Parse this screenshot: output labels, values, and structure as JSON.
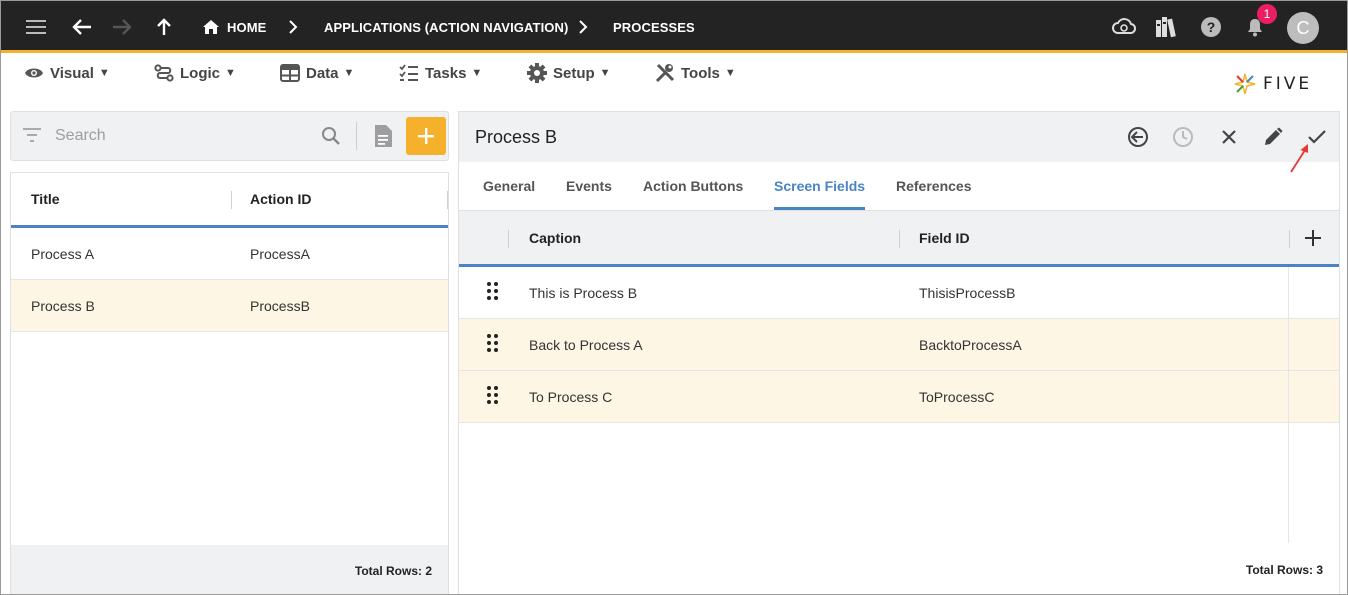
{
  "topbar": {
    "breadcrumbs": [
      {
        "label": "HOME"
      },
      {
        "label": "APPLICATIONS (ACTION NAVIGATION)"
      },
      {
        "label": "PROCESSES"
      }
    ],
    "notification_count": "1",
    "avatar_letter": "C"
  },
  "menu": {
    "items": [
      {
        "label": "Visual",
        "icon": "eye-icon"
      },
      {
        "label": "Logic",
        "icon": "logic-icon"
      },
      {
        "label": "Data",
        "icon": "table-icon"
      },
      {
        "label": "Tasks",
        "icon": "checklist-icon"
      },
      {
        "label": "Setup",
        "icon": "gear-icon"
      },
      {
        "label": "Tools",
        "icon": "tools-icon"
      }
    ],
    "caret": "▼"
  },
  "logo": {
    "text": "FIVE"
  },
  "left": {
    "search_placeholder": "Search",
    "columns": [
      "Title",
      "Action ID"
    ],
    "rows": [
      {
        "title": "Process A",
        "action_id": "ProcessA",
        "selected": false
      },
      {
        "title": "Process B",
        "action_id": "ProcessB",
        "selected": true
      }
    ],
    "total_rows": "Total Rows: 2"
  },
  "right": {
    "title": "Process B",
    "tabs": [
      {
        "label": "General"
      },
      {
        "label": "Events"
      },
      {
        "label": "Action Buttons"
      },
      {
        "label": "Screen Fields",
        "active": true
      },
      {
        "label": "References"
      }
    ],
    "columns": [
      "Caption",
      "Field ID"
    ],
    "rows": [
      {
        "caption": "This is Process B",
        "field_id": "ThisisProcessB"
      },
      {
        "caption": "Back to Process A",
        "field_id": "BacktoProcessA"
      },
      {
        "caption": "To Process C",
        "field_id": "ToProcessC"
      }
    ],
    "total_rows": "Total Rows: 3"
  },
  "colors": {
    "accent": "#f5b12b",
    "tab_active": "#4a84c4",
    "topbar": "#232323",
    "row_highlight": "#fdf6e4",
    "badge": "#e91e63"
  }
}
